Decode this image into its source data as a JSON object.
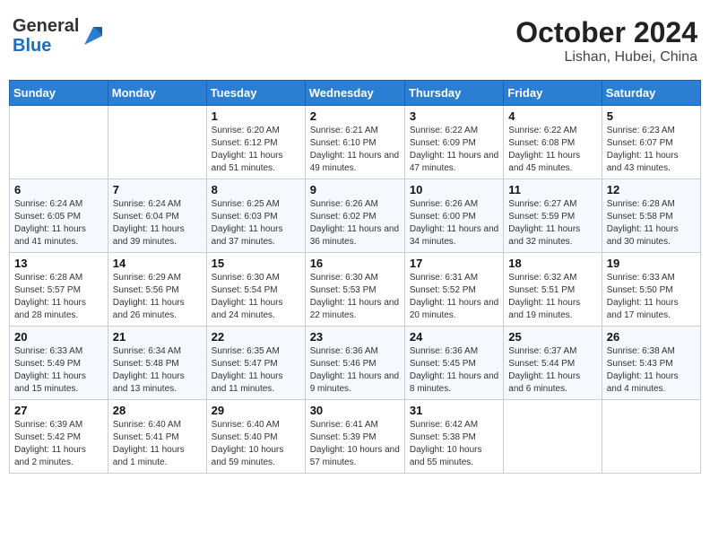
{
  "header": {
    "logo_general": "General",
    "logo_blue": "Blue",
    "month": "October 2024",
    "location": "Lishan, Hubei, China"
  },
  "weekdays": [
    "Sunday",
    "Monday",
    "Tuesday",
    "Wednesday",
    "Thursday",
    "Friday",
    "Saturday"
  ],
  "weeks": [
    [
      {
        "day": "",
        "sunrise": "",
        "sunset": "",
        "daylight": ""
      },
      {
        "day": "",
        "sunrise": "",
        "sunset": "",
        "daylight": ""
      },
      {
        "day": "1",
        "sunrise": "Sunrise: 6:20 AM",
        "sunset": "Sunset: 6:12 PM",
        "daylight": "Daylight: 11 hours and 51 minutes."
      },
      {
        "day": "2",
        "sunrise": "Sunrise: 6:21 AM",
        "sunset": "Sunset: 6:10 PM",
        "daylight": "Daylight: 11 hours and 49 minutes."
      },
      {
        "day": "3",
        "sunrise": "Sunrise: 6:22 AM",
        "sunset": "Sunset: 6:09 PM",
        "daylight": "Daylight: 11 hours and 47 minutes."
      },
      {
        "day": "4",
        "sunrise": "Sunrise: 6:22 AM",
        "sunset": "Sunset: 6:08 PM",
        "daylight": "Daylight: 11 hours and 45 minutes."
      },
      {
        "day": "5",
        "sunrise": "Sunrise: 6:23 AM",
        "sunset": "Sunset: 6:07 PM",
        "daylight": "Daylight: 11 hours and 43 minutes."
      }
    ],
    [
      {
        "day": "6",
        "sunrise": "Sunrise: 6:24 AM",
        "sunset": "Sunset: 6:05 PM",
        "daylight": "Daylight: 11 hours and 41 minutes."
      },
      {
        "day": "7",
        "sunrise": "Sunrise: 6:24 AM",
        "sunset": "Sunset: 6:04 PM",
        "daylight": "Daylight: 11 hours and 39 minutes."
      },
      {
        "day": "8",
        "sunrise": "Sunrise: 6:25 AM",
        "sunset": "Sunset: 6:03 PM",
        "daylight": "Daylight: 11 hours and 37 minutes."
      },
      {
        "day": "9",
        "sunrise": "Sunrise: 6:26 AM",
        "sunset": "Sunset: 6:02 PM",
        "daylight": "Daylight: 11 hours and 36 minutes."
      },
      {
        "day": "10",
        "sunrise": "Sunrise: 6:26 AM",
        "sunset": "Sunset: 6:00 PM",
        "daylight": "Daylight: 11 hours and 34 minutes."
      },
      {
        "day": "11",
        "sunrise": "Sunrise: 6:27 AM",
        "sunset": "Sunset: 5:59 PM",
        "daylight": "Daylight: 11 hours and 32 minutes."
      },
      {
        "day": "12",
        "sunrise": "Sunrise: 6:28 AM",
        "sunset": "Sunset: 5:58 PM",
        "daylight": "Daylight: 11 hours and 30 minutes."
      }
    ],
    [
      {
        "day": "13",
        "sunrise": "Sunrise: 6:28 AM",
        "sunset": "Sunset: 5:57 PM",
        "daylight": "Daylight: 11 hours and 28 minutes."
      },
      {
        "day": "14",
        "sunrise": "Sunrise: 6:29 AM",
        "sunset": "Sunset: 5:56 PM",
        "daylight": "Daylight: 11 hours and 26 minutes."
      },
      {
        "day": "15",
        "sunrise": "Sunrise: 6:30 AM",
        "sunset": "Sunset: 5:54 PM",
        "daylight": "Daylight: 11 hours and 24 minutes."
      },
      {
        "day": "16",
        "sunrise": "Sunrise: 6:30 AM",
        "sunset": "Sunset: 5:53 PM",
        "daylight": "Daylight: 11 hours and 22 minutes."
      },
      {
        "day": "17",
        "sunrise": "Sunrise: 6:31 AM",
        "sunset": "Sunset: 5:52 PM",
        "daylight": "Daylight: 11 hours and 20 minutes."
      },
      {
        "day": "18",
        "sunrise": "Sunrise: 6:32 AM",
        "sunset": "Sunset: 5:51 PM",
        "daylight": "Daylight: 11 hours and 19 minutes."
      },
      {
        "day": "19",
        "sunrise": "Sunrise: 6:33 AM",
        "sunset": "Sunset: 5:50 PM",
        "daylight": "Daylight: 11 hours and 17 minutes."
      }
    ],
    [
      {
        "day": "20",
        "sunrise": "Sunrise: 6:33 AM",
        "sunset": "Sunset: 5:49 PM",
        "daylight": "Daylight: 11 hours and 15 minutes."
      },
      {
        "day": "21",
        "sunrise": "Sunrise: 6:34 AM",
        "sunset": "Sunset: 5:48 PM",
        "daylight": "Daylight: 11 hours and 13 minutes."
      },
      {
        "day": "22",
        "sunrise": "Sunrise: 6:35 AM",
        "sunset": "Sunset: 5:47 PM",
        "daylight": "Daylight: 11 hours and 11 minutes."
      },
      {
        "day": "23",
        "sunrise": "Sunrise: 6:36 AM",
        "sunset": "Sunset: 5:46 PM",
        "daylight": "Daylight: 11 hours and 9 minutes."
      },
      {
        "day": "24",
        "sunrise": "Sunrise: 6:36 AM",
        "sunset": "Sunset: 5:45 PM",
        "daylight": "Daylight: 11 hours and 8 minutes."
      },
      {
        "day": "25",
        "sunrise": "Sunrise: 6:37 AM",
        "sunset": "Sunset: 5:44 PM",
        "daylight": "Daylight: 11 hours and 6 minutes."
      },
      {
        "day": "26",
        "sunrise": "Sunrise: 6:38 AM",
        "sunset": "Sunset: 5:43 PM",
        "daylight": "Daylight: 11 hours and 4 minutes."
      }
    ],
    [
      {
        "day": "27",
        "sunrise": "Sunrise: 6:39 AM",
        "sunset": "Sunset: 5:42 PM",
        "daylight": "Daylight: 11 hours and 2 minutes."
      },
      {
        "day": "28",
        "sunrise": "Sunrise: 6:40 AM",
        "sunset": "Sunset: 5:41 PM",
        "daylight": "Daylight: 11 hours and 1 minute."
      },
      {
        "day": "29",
        "sunrise": "Sunrise: 6:40 AM",
        "sunset": "Sunset: 5:40 PM",
        "daylight": "Daylight: 10 hours and 59 minutes."
      },
      {
        "day": "30",
        "sunrise": "Sunrise: 6:41 AM",
        "sunset": "Sunset: 5:39 PM",
        "daylight": "Daylight: 10 hours and 57 minutes."
      },
      {
        "day": "31",
        "sunrise": "Sunrise: 6:42 AM",
        "sunset": "Sunset: 5:38 PM",
        "daylight": "Daylight: 10 hours and 55 minutes."
      },
      {
        "day": "",
        "sunrise": "",
        "sunset": "",
        "daylight": ""
      },
      {
        "day": "",
        "sunrise": "",
        "sunset": "",
        "daylight": ""
      }
    ]
  ]
}
